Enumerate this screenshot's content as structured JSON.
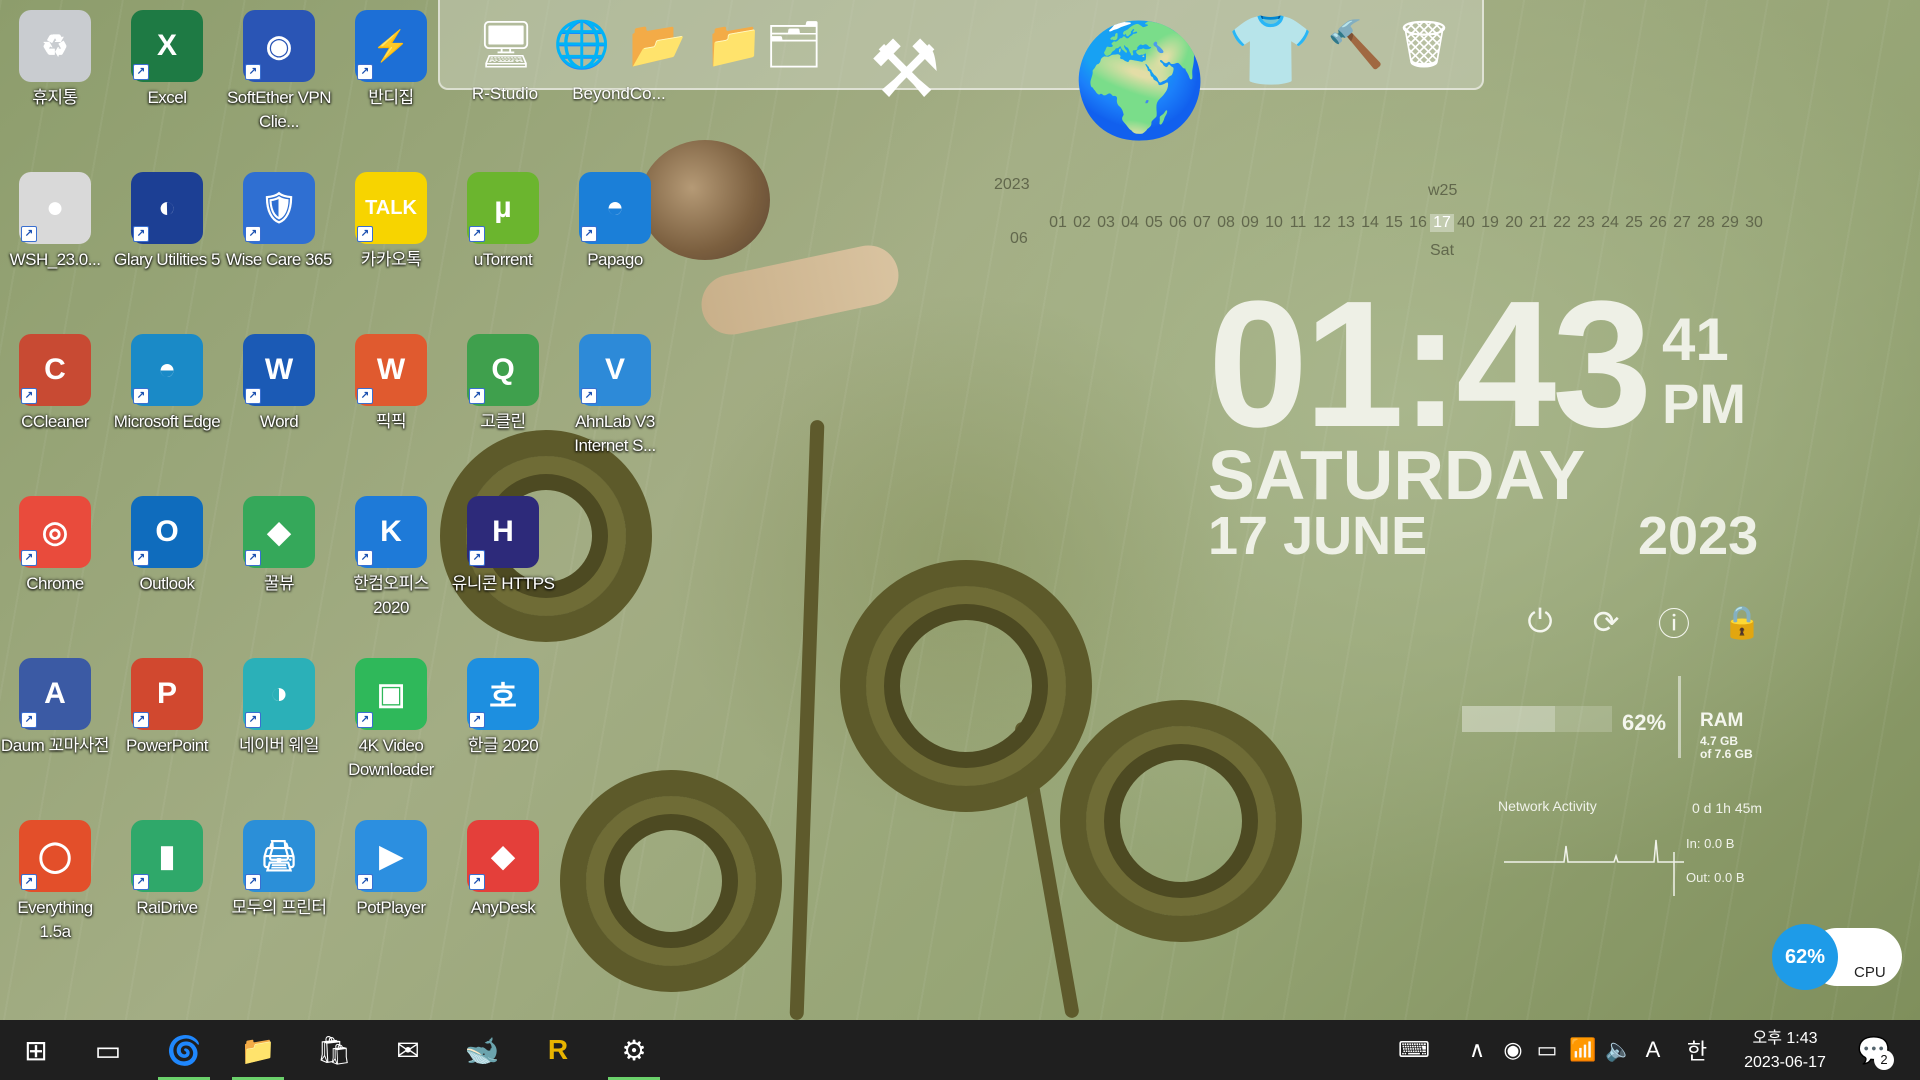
{
  "desktop": {
    "icons": [
      {
        "label": "휴지통",
        "icon": "recycle-bin-icon"
      },
      {
        "label": "Excel",
        "icon": "excel-icon"
      },
      {
        "label": "SoftEther VPN Clie...",
        "icon": "softether-vpn-icon"
      },
      {
        "label": "반디집",
        "icon": "bandizip-icon"
      },
      {
        "label": "WSH_23.0...",
        "icon": "wsh-installer-icon"
      },
      {
        "label": "Glary Utilities 5",
        "icon": "glary-utilities-icon"
      },
      {
        "label": "Wise Care 365",
        "icon": "wise-care-icon"
      },
      {
        "label": "카카오톡",
        "icon": "kakaotalk-icon"
      },
      {
        "label": "uTorrent",
        "icon": "utorrent-icon"
      },
      {
        "label": "Papago",
        "icon": "papago-icon"
      },
      {
        "label": "CCleaner",
        "icon": "ccleaner-icon"
      },
      {
        "label": "Microsoft Edge",
        "icon": "edge-icon"
      },
      {
        "label": "Word",
        "icon": "word-icon"
      },
      {
        "label": "픽픽",
        "icon": "picpick-icon"
      },
      {
        "label": "고클린",
        "icon": "goclean-icon"
      },
      {
        "label": "AhnLab V3 Internet S...",
        "icon": "ahnlab-v3-icon"
      },
      {
        "label": "Chrome",
        "icon": "chrome-icon"
      },
      {
        "label": "Outlook",
        "icon": "outlook-icon"
      },
      {
        "label": "꿀뷰",
        "icon": "honeyview-icon"
      },
      {
        "label": "한컴오피스 2020",
        "icon": "hancom-office-icon"
      },
      {
        "label": "유니콘 HTTPS",
        "icon": "unicorn-https-icon"
      },
      {
        "label": "Daum 꼬마사전",
        "icon": "daum-dictionary-icon"
      },
      {
        "label": "PowerPoint",
        "icon": "powerpoint-icon"
      },
      {
        "label": "네이버 웨일",
        "icon": "naver-whale-icon"
      },
      {
        "label": "4K Video Downloader",
        "icon": "4k-video-downloader-icon"
      },
      {
        "label": "한글 2020",
        "icon": "hangul-icon"
      },
      {
        "label": "Everything 1.5a",
        "icon": "everything-search-icon"
      },
      {
        "label": "RaiDrive",
        "icon": "raidrive-icon"
      },
      {
        "label": "모두의 프린터",
        "icon": "modu-printer-icon"
      },
      {
        "label": "PotPlayer",
        "icon": "potplayer-icon"
      },
      {
        "label": "AnyDesk",
        "icon": "anydesk-icon"
      }
    ]
  },
  "dock": {
    "items": [
      {
        "label": "R-Studio",
        "icon": "r-studio-icon"
      },
      {
        "label": "BeyondCo...",
        "icon": "beyond-compare-icon"
      },
      {
        "label": "",
        "icon": "folder-icon"
      },
      {
        "label": "",
        "icon": "folder-icon"
      },
      {
        "label": "",
        "icon": "tools-icon"
      },
      {
        "label": "",
        "icon": "globe-icon"
      },
      {
        "label": "",
        "icon": "tshirt-icon"
      },
      {
        "label": "",
        "icon": "hammer-wrench-icon"
      },
      {
        "label": "",
        "icon": "recycle-bin-icon"
      }
    ]
  },
  "calendar": {
    "year": "2023",
    "month": "06",
    "week": "w25",
    "weekday": "Sat",
    "days": [
      "01",
      "02",
      "03",
      "04",
      "05",
      "06",
      "07",
      "08",
      "09",
      "10",
      "11",
      "12",
      "13",
      "14",
      "15",
      "16",
      "17",
      "40",
      "19",
      "20",
      "21",
      "22",
      "23",
      "24",
      "25",
      "26",
      "27",
      "28",
      "29",
      "30"
    ],
    "today": "17"
  },
  "clock": {
    "time": "01:43",
    "seconds": "41",
    "ampm": "PM",
    "weekday": "SATURDAY",
    "date": "17 JUNE",
    "year": "2023"
  },
  "power_buttons": [
    {
      "name": "shutdown",
      "icon": "power-icon"
    },
    {
      "name": "restart",
      "icon": "restart-icon"
    },
    {
      "name": "logoff",
      "icon": "logoff-icon"
    },
    {
      "name": "lock",
      "icon": "lock-icon"
    }
  ],
  "ram": {
    "percent": "62%",
    "percent_value": 0.62,
    "label": "RAM",
    "used": "4.7 GB",
    "total": "of 7.6 GB"
  },
  "network": {
    "title": "Network Activity",
    "uptime": "0 d 1h 45m",
    "in": "In: 0.0 B",
    "out": "Out: 0.0 B"
  },
  "cpu": {
    "percent": "62%",
    "label": "CPU",
    "color": "#1e9be8"
  },
  "taskbar": {
    "apps": [
      {
        "name": "start",
        "icon": "windows-start-icon"
      },
      {
        "name": "task-view",
        "icon": "task-view-icon"
      },
      {
        "name": "edge",
        "icon": "edge-icon",
        "active": true
      },
      {
        "name": "file-explorer",
        "icon": "folder-icon",
        "active": true
      },
      {
        "name": "store",
        "icon": "store-icon"
      },
      {
        "name": "mail",
        "icon": "mail-icon"
      },
      {
        "name": "whale",
        "icon": "naver-whale-icon"
      },
      {
        "name": "r-app",
        "icon": "r-app-icon"
      },
      {
        "name": "settings",
        "icon": "gear-icon",
        "active": true
      }
    ],
    "tray": {
      "ime_mode": "A",
      "ime_lang": "한",
      "time": "오후 1:43",
      "date": "2023-06-17",
      "notifications": "2"
    }
  }
}
